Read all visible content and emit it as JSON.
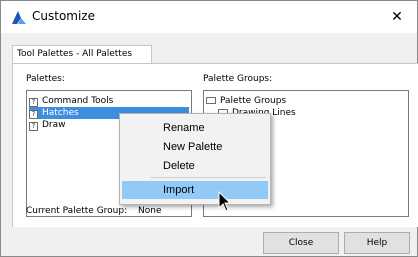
{
  "window": {
    "title": "Customize",
    "close_label": "✕"
  },
  "tabs": [
    {
      "label": "Tool Palettes - All Palettes"
    }
  ],
  "palettes": {
    "label": "Palettes:",
    "items": [
      {
        "label": "Command Tools",
        "icon": "palette-icon"
      },
      {
        "label": "Hatches",
        "icon": "palette-icon",
        "selected": true
      },
      {
        "label": "Draw",
        "icon": "palette-icon"
      }
    ]
  },
  "palette_groups": {
    "label": "Palette Groups:",
    "root": "Palette Groups",
    "child": "Drawing Lines"
  },
  "current_group": {
    "label": "Current Palette Group:",
    "value": "None"
  },
  "context_menu": {
    "items": [
      {
        "label": "Rename"
      },
      {
        "label": "New Palette"
      },
      {
        "label": "Delete"
      },
      {
        "label": "Import",
        "highlighted": true
      }
    ]
  },
  "buttons": {
    "close": "Close",
    "help": "Help"
  },
  "colors": {
    "selection": "#3e8ee0",
    "menu_highlight": "#91c9f7",
    "app_icon": "#2b64c8"
  }
}
